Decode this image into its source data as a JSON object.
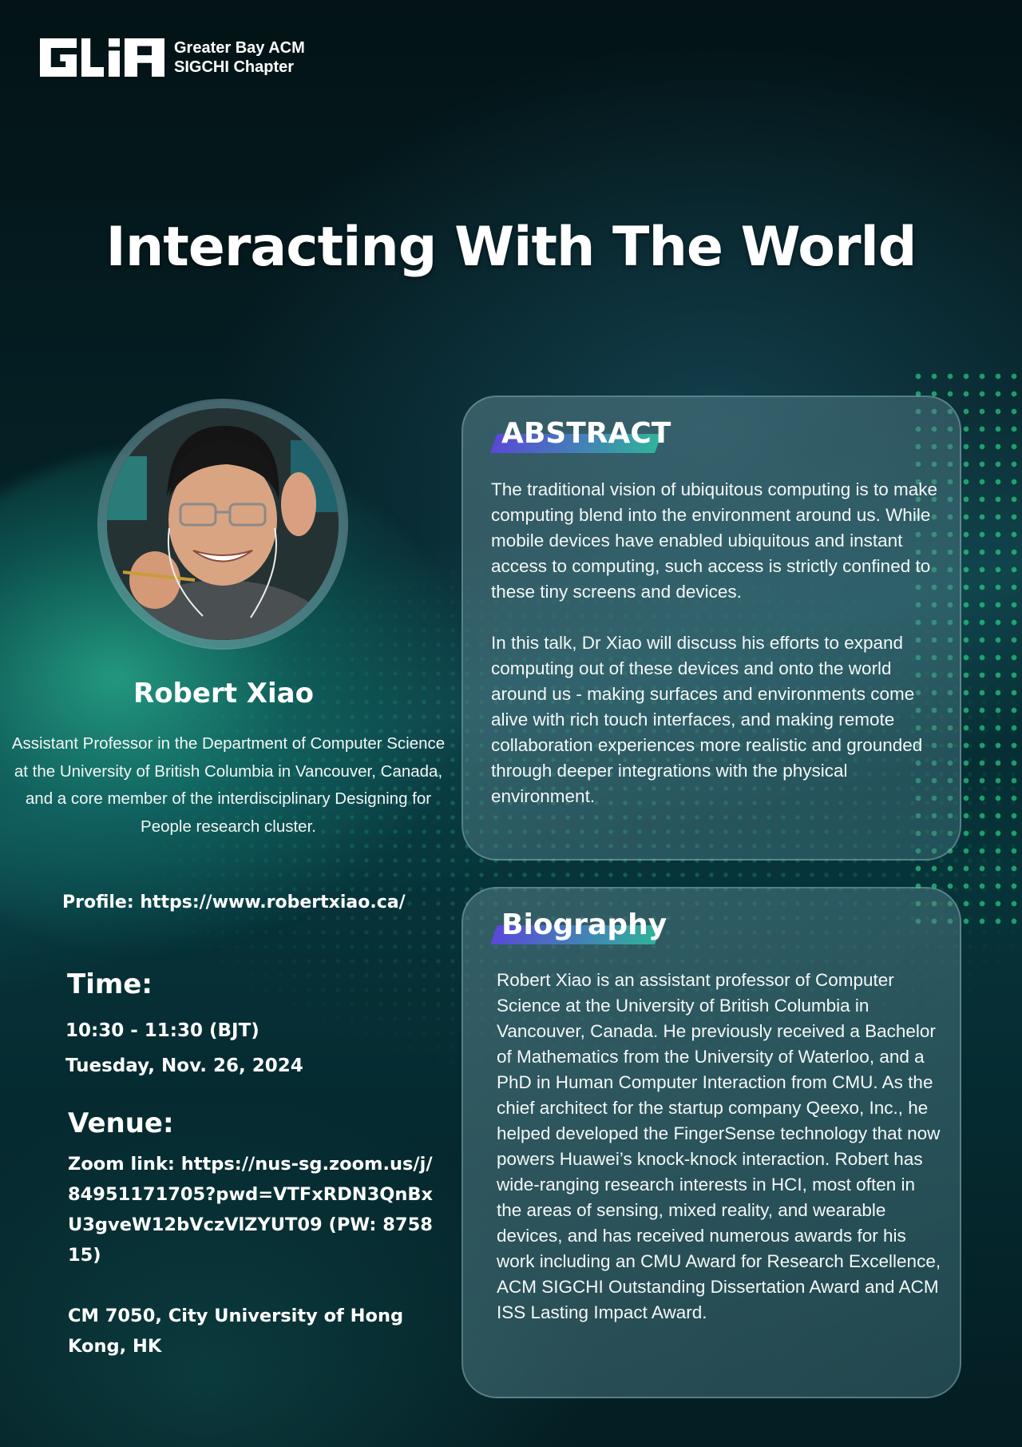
{
  "logo": {
    "name": "GBA SIGCHI logo",
    "line1": "Greater Bay ACM",
    "line2": "SIGCHI Chapter"
  },
  "title": "Interacting With The World",
  "speaker": {
    "name": "Robert Xiao",
    "affiliation": "Assistant Professor in the Department of Computer Science at the University of British Columbia in Vancouver, Canada, and a core member of the interdisciplinary Designing for People research cluster.",
    "profile": "Profile: https://www.robertxiao.ca/"
  },
  "time": {
    "heading": "Time:",
    "hours": "10:30 - 11:30 (BJT)",
    "date": "Tuesday, Nov. 26, 2024"
  },
  "venue": {
    "heading": "Venue:",
    "zoom": "Zoom link: https://nus-sg.zoom.us/j/84951171705?pwd=VTFxRDN3QnBxU3gveW12bVczVlZYUT09 (PW: 875815)",
    "location": "CM 7050, City University of Hong Kong, HK"
  },
  "abstract": {
    "heading": "ABSTRACT",
    "p1": "The traditional vision of ubiquitous computing is to make computing blend into the environment around us. While mobile devices have enabled ubiquitous and instant access to computing, such access is strictly confined to these tiny screens and devices.",
    "p2": "In this talk, Dr Xiao will discuss his efforts to expand computing out of these devices and onto the world around us - making surfaces and environments come alive with rich touch interfaces, and making remote collaboration experiences more realistic and grounded through deeper integrations with the physical environment."
  },
  "biography": {
    "heading": "Biography",
    "text": "Robert Xiao is an assistant professor of Computer Science at the University of British Columbia in Vancouver, Canada. He previously received a Bachelor of Mathematics from the University of Waterloo, and a PhD in Human Computer Interaction from CMU. As the chief architect for the startup company Qeexo, Inc., he helped developed the FingerSense technology that now powers Huawei’s knock-knock interaction. Robert has wide-ranging research interests in HCI, most often in the areas of sensing, mixed reality, and wearable devices, and has received numerous awards for his work including an CMU Award for Research Excellence, ACM SIGCHI Outstanding Dissertation Award and ACM ISS Lasting Impact Award."
  },
  "colors": {
    "accent_purple": "#5a48d8",
    "accent_green": "#2fb39a",
    "background": "#03171a"
  }
}
